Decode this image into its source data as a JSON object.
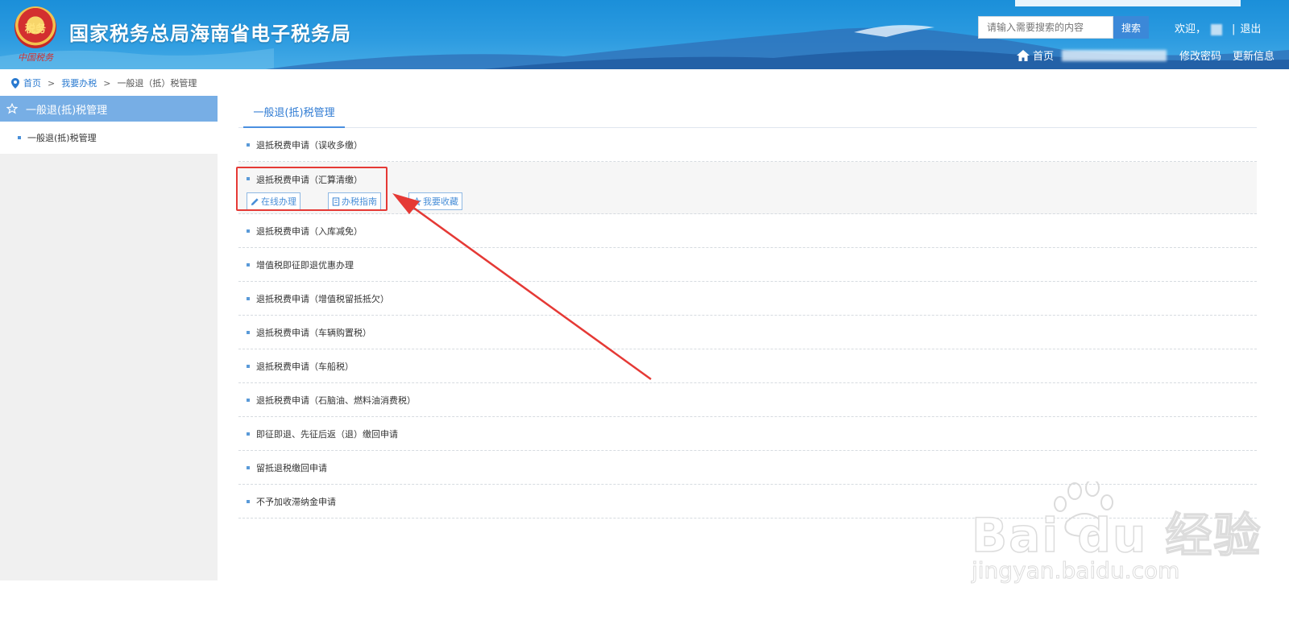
{
  "header": {
    "emblem_label": "税务",
    "emblem_script": "中国税务",
    "site_title": "国家税务总局海南省电子税务局",
    "search_placeholder": "请输入需要搜索的内容",
    "search_button": "搜索",
    "welcome": "欢迎，",
    "separator": "|",
    "logout": "退出",
    "home": "首页",
    "change_password": "修改密码",
    "update_info": "更新信息"
  },
  "breadcrumb": {
    "home": "首页",
    "level2": "我要办税",
    "current": "一般退（抵）税管理",
    "sep": ">"
  },
  "sidebar": {
    "header": "一般退(抵)税管理",
    "items": [
      {
        "label": "一般退(抵)税管理"
      }
    ]
  },
  "main": {
    "tab": "一般退(抵)税管理",
    "items": [
      {
        "label": "退抵税费申请（误收多缴）"
      },
      {
        "label": "退抵税费申请（汇算清缴）"
      },
      {
        "label": "退抵税费申请（入库减免）"
      },
      {
        "label": "增值税即征即退优惠办理"
      },
      {
        "label": "退抵税费申请（增值税留抵抵欠）"
      },
      {
        "label": "退抵税费申请（车辆购置税）"
      },
      {
        "label": "退抵税费申请（车船税）"
      },
      {
        "label": "退抵税费申请（石脑油、燃料油消费税）"
      },
      {
        "label": "即征即退、先征后返（退）缴回申请"
      },
      {
        "label": "留抵退税缴回申请"
      },
      {
        "label": "不予加收滞纳金申请"
      }
    ],
    "actions": {
      "online": "在线办理",
      "guide": "办税指南",
      "favorite": "我要收藏"
    }
  },
  "watermark": {
    "brand": "Bai du 经验",
    "url": "jingyan.baidu.com"
  },
  "colors": {
    "header_blue": "#2c9be0",
    "sidebar_header": "#77aee5",
    "accent": "#2f7bd3",
    "annotation_red": "#e53935"
  }
}
